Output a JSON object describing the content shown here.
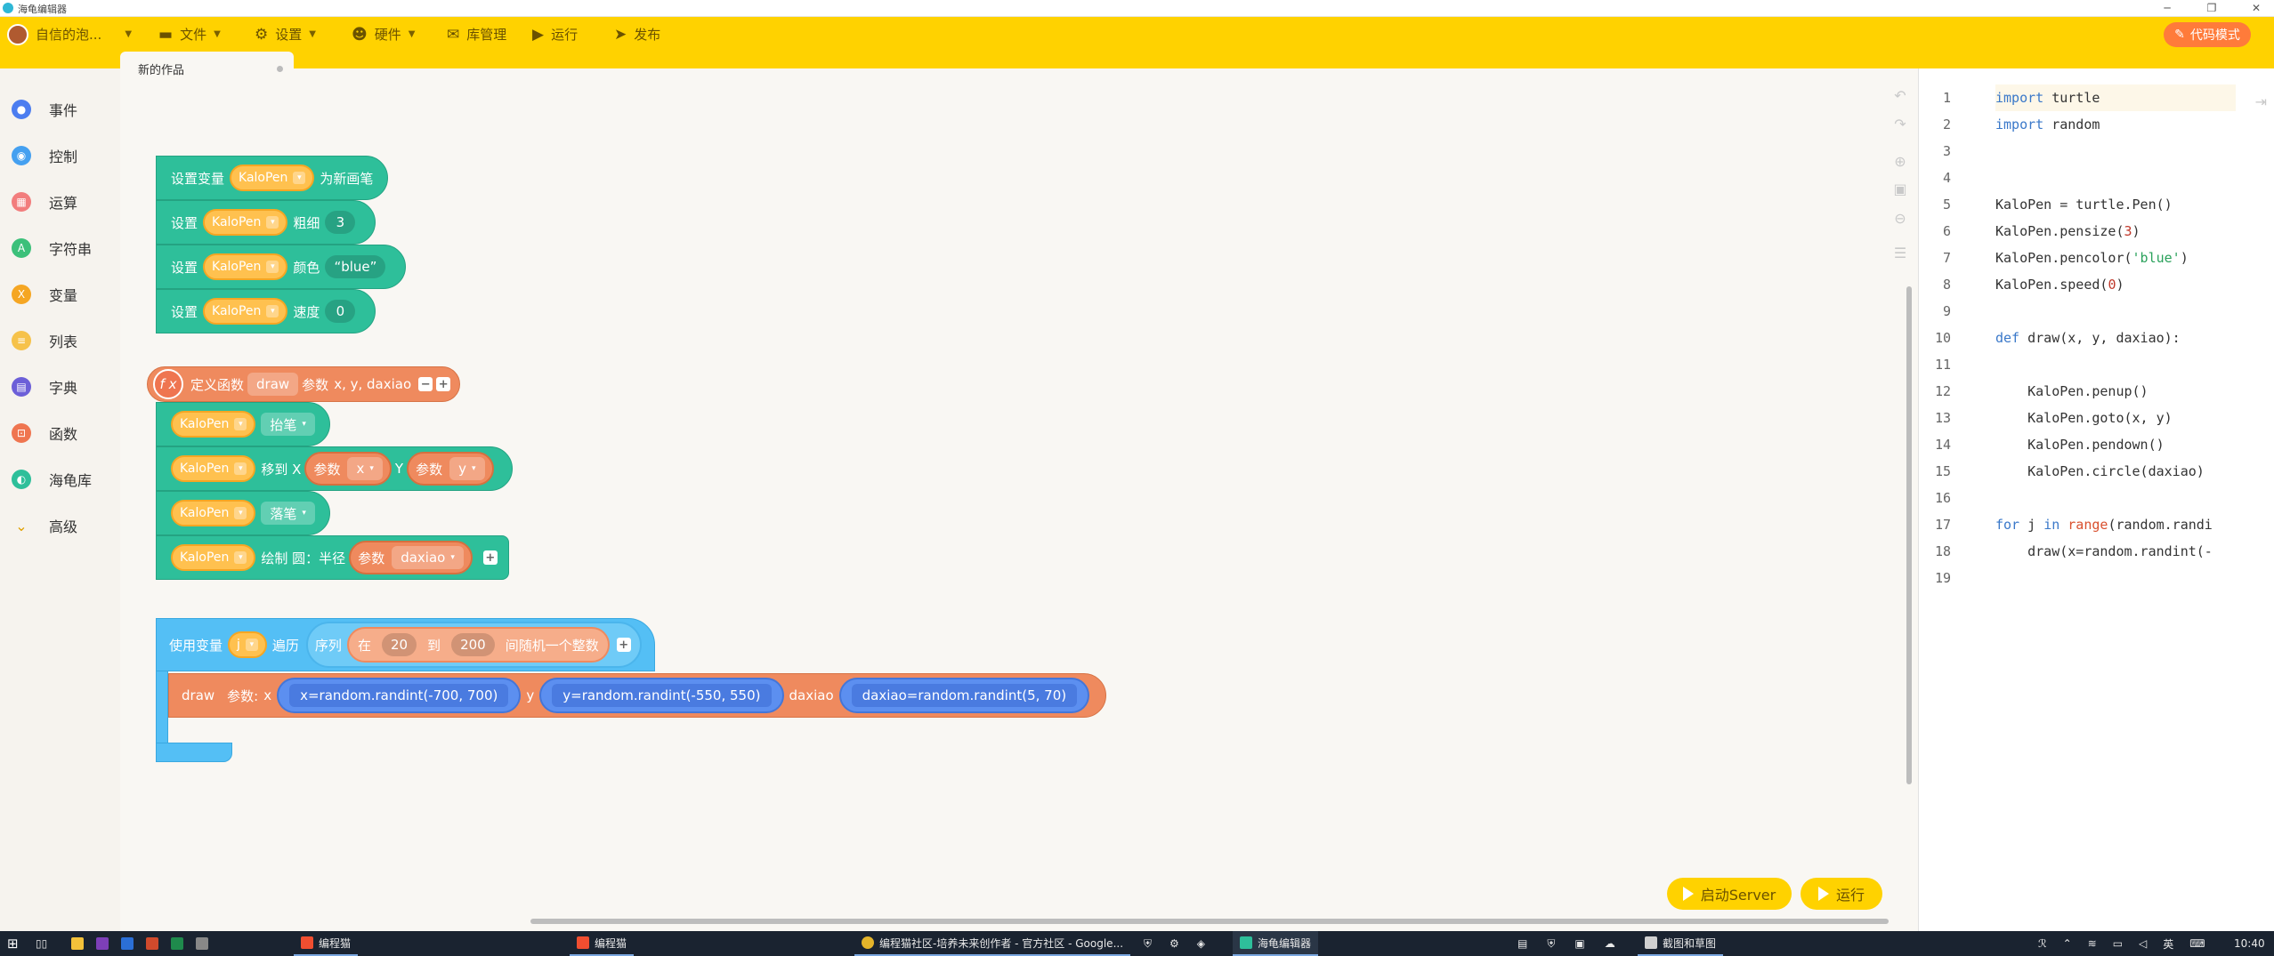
{
  "window": {
    "title": "海龟编辑器"
  },
  "toolbar": {
    "user": "自信的泡...",
    "menus": [
      {
        "label": "文件",
        "icon": "folder-icon",
        "caret": true
      },
      {
        "label": "设置",
        "icon": "gear-icon",
        "caret": true
      },
      {
        "label": "硬件",
        "icon": "robot-icon",
        "caret": true
      },
      {
        "label": "库管理",
        "icon": "library-icon",
        "caret": false
      },
      {
        "label": "运行",
        "icon": "run-icon",
        "caret": false
      },
      {
        "label": "发布",
        "icon": "send-icon",
        "caret": false
      }
    ],
    "code_mode": "代码模式"
  },
  "tab": {
    "label": "新的作品"
  },
  "sidebar": {
    "items": [
      {
        "label": "事件",
        "color": "#4c7df0"
      },
      {
        "label": "控制",
        "color": "#45a0f0"
      },
      {
        "label": "运算",
        "color": "#f27d7d"
      },
      {
        "label": "字符串",
        "color": "#3cc07a"
      },
      {
        "label": "变量",
        "color": "#f5a623"
      },
      {
        "label": "列表",
        "color": "#f6c24a"
      },
      {
        "label": "字典",
        "color": "#6c5fd8"
      },
      {
        "label": "函数",
        "color": "#ef7550"
      },
      {
        "label": "海龟库",
        "color": "#2ebf9a"
      },
      {
        "label": "高级",
        "color": "#e0a000"
      }
    ]
  },
  "blocks": {
    "set_var": {
      "prefix": "设置变量",
      "var": "KaloPen",
      "suffix": "为新画笔"
    },
    "set_width": {
      "prefix": "设置",
      "var": "KaloPen",
      "label": "粗细",
      "value": "3"
    },
    "set_color": {
      "prefix": "设置",
      "var": "KaloPen",
      "label": "颜色",
      "value": "“blue”"
    },
    "set_speed": {
      "prefix": "设置",
      "var": "KaloPen",
      "label": "速度",
      "value": "0"
    },
    "def": {
      "fx": "f x",
      "label": "定义函数",
      "name": "draw",
      "params_label": "参数",
      "params": "x, y, daxiao"
    },
    "penup": {
      "var": "KaloPen",
      "action": "抬笔"
    },
    "goto": {
      "var": "KaloPen",
      "label": "移到 X",
      "p1_label": "参数",
      "p1": "x",
      "y_label": "Y",
      "p2_label": "参数",
      "p2": "y"
    },
    "pendown": {
      "var": "KaloPen",
      "action": "落笔"
    },
    "circle": {
      "var": "KaloPen",
      "label": "绘制 圆：半径",
      "p_label": "参数",
      "p": "daxiao"
    },
    "loop": {
      "label": "使用变量",
      "var": "j",
      "iter": "遍历",
      "seq": "序列",
      "from_label": "在",
      "from": "20",
      "to_label": "到",
      "to": "200",
      "tail": "间随机一个整数"
    },
    "call": {
      "name": "draw",
      "params_label": "参数:",
      "x_label": "x",
      "x": "x=random.randint(-700, 700)",
      "y_label": "y",
      "y": "y=random.randint(-550, 550)",
      "d_label": "daxiao",
      "d": "daxiao=random.randint(5, 70)"
    }
  },
  "buttons": {
    "server": "启动Server",
    "run": "运行"
  },
  "editor": {
    "lines": [
      "<span class='kw'>import</span> turtle",
      "<span class='kw'>import</span> random",
      "",
      "",
      "KaloPen = turtle.Pen()",
      "KaloPen.pensize(<span class='nm'>3</span>)",
      "KaloPen.pencolor(<span class='st'>'blue'</span>)",
      "KaloPen.speed(<span class='nm'>0</span>)",
      "",
      "<span class='kw'>def</span> draw(x, y, daxiao):",
      "",
      "    KaloPen.penup()",
      "    KaloPen.goto(x, y)",
      "    KaloPen.pendown()",
      "    KaloPen.circle(daxiao)",
      "",
      "<span class='kw'>for</span> j <span class='kw'>in</span> <span class='bi'>range</span>(random.randi",
      "    draw(x=random.randint(-",
      ""
    ]
  },
  "taskbar": {
    "apps": [
      "编程猫",
      "编程猫",
      "编程猫社区-培养未来创作者 - 官方社区 - Google...",
      "海龟编辑器",
      "截图和草图"
    ],
    "lang": "英",
    "time": "10:40"
  }
}
